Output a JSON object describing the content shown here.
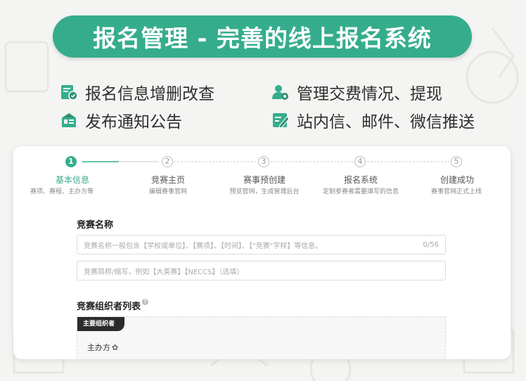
{
  "banner": {
    "title": "报名管理 - 完善的线上报名系统"
  },
  "features": [
    {
      "label": "报名信息增删改查",
      "icon": "form-edit-icon"
    },
    {
      "label": "管理交费情况、提现",
      "icon": "user-settings-icon"
    },
    {
      "label": "发布通知公告",
      "icon": "announcement-icon"
    },
    {
      "label": "站内信、邮件、微信推送",
      "icon": "message-edit-icon"
    }
  ],
  "steps": [
    {
      "num": "1",
      "label": "基本信息",
      "sub": "赛项、赛程、主办方等"
    },
    {
      "num": "2",
      "label": "竞赛主页",
      "sub": "编辑赛事官网"
    },
    {
      "num": "3",
      "label": "赛事预创建",
      "sub": "预览官网，生成管理后台"
    },
    {
      "num": "4",
      "label": "报名系统",
      "sub": "定制参赛者需要填写的信息"
    },
    {
      "num": "5",
      "label": "创建成功",
      "sub": "赛事官网正式上线"
    }
  ],
  "form": {
    "name_title": "竞赛名称",
    "name_placeholder": "竞赛名称一般包含【学校或单位】、【赛项】、【时间】、【\"竞赛\"字样】等信息。",
    "name_count": "0/56",
    "abbr_placeholder": "竞赛简称/缩写，例如【大英赛】【NECCS】（选填）",
    "organizer_title": "竞赛组织者列表",
    "help": "?",
    "organizer_tag": "主要组织者",
    "host_label": "主办方"
  },
  "colors": {
    "accent": "#35ad8c",
    "dark_tag": "#2b2b2b"
  }
}
